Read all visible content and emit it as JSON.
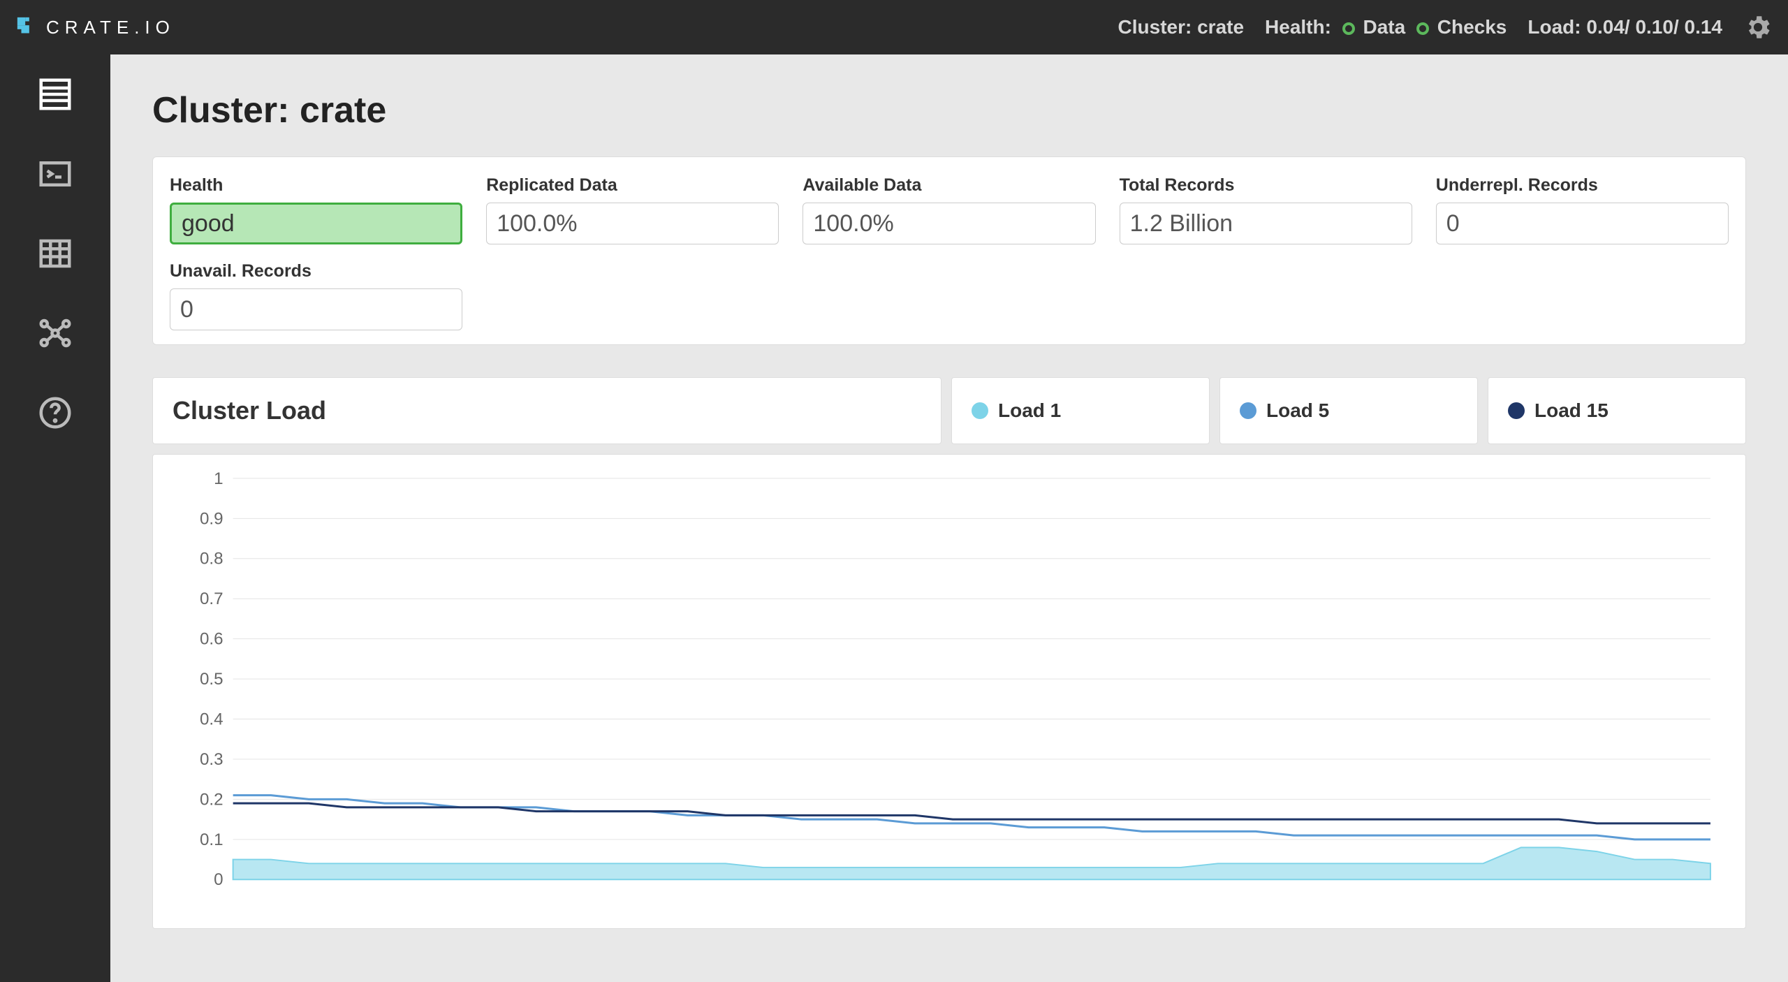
{
  "header": {
    "brand": "CRATE.IO",
    "cluster_label": "Cluster:",
    "cluster_name": "crate",
    "health_label": "Health:",
    "data_label": "Data",
    "checks_label": "Checks",
    "load_label": "Load:",
    "load_values": "0.04/ 0.10/ 0.14"
  },
  "page": {
    "title_prefix": "Cluster:",
    "title_name": "crate"
  },
  "stats": [
    {
      "label": "Health",
      "value": "good",
      "kind": "health-good"
    },
    {
      "label": "Replicated Data",
      "value": "100.0%",
      "kind": ""
    },
    {
      "label": "Available Data",
      "value": "100.0%",
      "kind": ""
    },
    {
      "label": "Total Records",
      "value": "1.2 Billion",
      "kind": ""
    },
    {
      "label": "Underrepl. Records",
      "value": "0",
      "kind": ""
    },
    {
      "label": "Unavail. Records",
      "value": "0",
      "kind": ""
    }
  ],
  "chart": {
    "title": "Cluster Load",
    "legend": [
      {
        "name": "Load 1",
        "color": "#7dd3e8"
      },
      {
        "name": "Load 5",
        "color": "#5b9bd5"
      },
      {
        "name": "Load 15",
        "color": "#1f3667"
      }
    ]
  },
  "chart_data": {
    "type": "line",
    "title": "Cluster Load",
    "ylabel": "",
    "xlabel": "",
    "ylim": [
      0,
      1
    ],
    "y_ticks": [
      0,
      0.1,
      0.2,
      0.3,
      0.4,
      0.5,
      0.6,
      0.7,
      0.8,
      0.9,
      1
    ],
    "x": [
      0,
      1,
      2,
      3,
      4,
      5,
      6,
      7,
      8,
      9,
      10,
      11,
      12,
      13,
      14,
      15,
      16,
      17,
      18,
      19,
      20,
      21,
      22,
      23,
      24,
      25,
      26,
      27,
      28,
      29,
      30,
      31,
      32,
      33,
      34,
      35,
      36,
      37,
      38,
      39
    ],
    "series": [
      {
        "name": "Load 1",
        "color": "#7dd3e8",
        "fill": true,
        "values": [
          0.05,
          0.05,
          0.04,
          0.04,
          0.04,
          0.04,
          0.04,
          0.04,
          0.04,
          0.04,
          0.04,
          0.04,
          0.04,
          0.04,
          0.03,
          0.03,
          0.03,
          0.03,
          0.03,
          0.03,
          0.03,
          0.03,
          0.03,
          0.03,
          0.03,
          0.03,
          0.04,
          0.04,
          0.04,
          0.04,
          0.04,
          0.04,
          0.04,
          0.04,
          0.08,
          0.08,
          0.07,
          0.05,
          0.05,
          0.04
        ]
      },
      {
        "name": "Load 5",
        "color": "#5b9bd5",
        "fill": false,
        "values": [
          0.21,
          0.21,
          0.2,
          0.2,
          0.19,
          0.19,
          0.18,
          0.18,
          0.18,
          0.17,
          0.17,
          0.17,
          0.16,
          0.16,
          0.16,
          0.15,
          0.15,
          0.15,
          0.14,
          0.14,
          0.14,
          0.13,
          0.13,
          0.13,
          0.12,
          0.12,
          0.12,
          0.12,
          0.11,
          0.11,
          0.11,
          0.11,
          0.11,
          0.11,
          0.11,
          0.11,
          0.11,
          0.1,
          0.1,
          0.1
        ]
      },
      {
        "name": "Load 15",
        "color": "#1f3667",
        "fill": false,
        "values": [
          0.19,
          0.19,
          0.19,
          0.18,
          0.18,
          0.18,
          0.18,
          0.18,
          0.17,
          0.17,
          0.17,
          0.17,
          0.17,
          0.16,
          0.16,
          0.16,
          0.16,
          0.16,
          0.16,
          0.15,
          0.15,
          0.15,
          0.15,
          0.15,
          0.15,
          0.15,
          0.15,
          0.15,
          0.15,
          0.15,
          0.15,
          0.15,
          0.15,
          0.15,
          0.15,
          0.15,
          0.14,
          0.14,
          0.14,
          0.14
        ]
      }
    ]
  }
}
